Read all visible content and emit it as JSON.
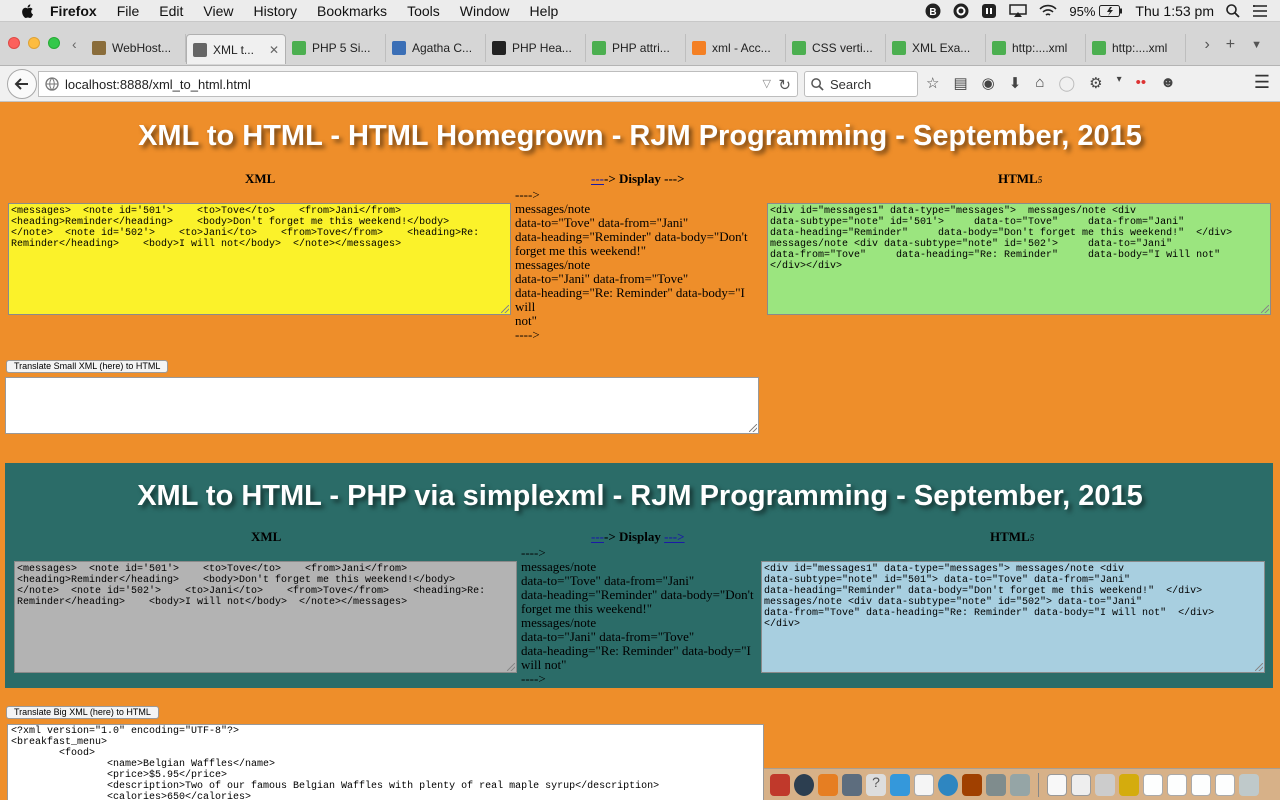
{
  "menubar": {
    "app_name": "Firefox",
    "items": [
      "File",
      "Edit",
      "View",
      "History",
      "Bookmarks",
      "Tools",
      "Window",
      "Help"
    ],
    "battery": "95%",
    "clock": "Thu 1:53 pm"
  },
  "tabs": [
    {
      "label": "WebHost...",
      "icon": "webhost-icon",
      "color": "#8a6d3b",
      "active": false
    },
    {
      "label": "XML t...",
      "icon": "globe-icon",
      "color": "#666666",
      "active": true
    },
    {
      "label": "PHP 5 Si...",
      "icon": "w3schools-icon",
      "color": "#4caf50",
      "active": false
    },
    {
      "label": "Agatha C...",
      "icon": "chrome-style-icon",
      "color": "#3b6fb6",
      "active": false
    },
    {
      "label": "PHP Hea...",
      "icon": "github-icon",
      "color": "#222222",
      "active": false
    },
    {
      "label": "PHP attri...",
      "icon": "w3schools-icon",
      "color": "#4caf50",
      "active": false
    },
    {
      "label": "xml - Acc...",
      "icon": "stackoverflow-icon",
      "color": "#f48024",
      "active": false
    },
    {
      "label": "CSS verti...",
      "icon": "w3schools-icon",
      "color": "#4caf50",
      "active": false
    },
    {
      "label": "XML Exa...",
      "icon": "w3schools-icon",
      "color": "#4caf50",
      "active": false
    },
    {
      "label": "http:....xml",
      "icon": "w3schools-icon",
      "color": "#4caf50",
      "active": false
    },
    {
      "label": "http:....xml",
      "icon": "w3schools-icon",
      "color": "#4caf50",
      "active": false
    }
  ],
  "navbar": {
    "url": "localhost:8888/xml_to_html.html",
    "search_placeholder": "Search"
  },
  "section1": {
    "title": "XML to HTML - HTML Homegrown - RJM Programming - September, 2015",
    "col_xml": "XML",
    "col_display_prefix": "---",
    "col_display": "-> Display --->",
    "col_html": "HTML",
    "col_html_suffix": "5",
    "xml_text": "<messages>  <note id='501'>    <to>Tove</to>    <from>Jani</from>\n<heading>Reminder</heading>    <body>Don't forget me this weekend!</body>\n</note>  <note id='502'>    <to>Jani</to>    <from>Tove</from>    <heading>Re:\nReminder</heading>    <body>I will not</body>  </note></messages>",
    "display_lines": [
      "---->",
      "messages/note",
      "data-to=\"Tove\" data-from=\"Jani\"",
      "data-heading=\"Reminder\" data-body=\"Don't",
      "forget me this weekend!\"",
      "messages/note",
      "data-to=\"Jani\" data-from=\"Tove\"",
      "data-heading=\"Re: Reminder\" data-body=\"I will",
      "not\"",
      "---->"
    ],
    "html_text": "<div id=\"messages1\" data-type=\"messages\">  messages/note <div\ndata-subtype=\"note\" id='501'>     data-to=\"Tove\"     data-from=\"Jani\"\ndata-heading=\"Reminder\"     data-body=\"Don't forget me this weekend!\"  </div>\nmessages/note <div data-subtype=\"note\" id='502'>     data-to=\"Jani\"\ndata-from=\"Tove\"     data-heading=\"Re: Reminder\"     data-body=\"I will not\"\n</div></div>",
    "button_label": "Translate Small XML (here) to HTML"
  },
  "section2": {
    "title": "XML to HTML - PHP via simplexml - RJM Programming - September, 2015",
    "col_xml": "XML",
    "col_display_prefix": "---",
    "col_display": "-> Display ",
    "col_display_suffix": "--->",
    "col_html": "HTML",
    "col_html_suffix": "5",
    "xml_text": "<messages>  <note id='501'>    <to>Tove</to>    <from>Jani</from>\n<heading>Reminder</heading>    <body>Don't forget me this weekend!</body>\n</note>  <note id='502'>    <to>Jani</to>    <from>Tove</from>    <heading>Re:\nReminder</heading>    <body>I will not</body>  </note></messages>",
    "display_lines": [
      "---->",
      "messages/note",
      "data-to=\"Tove\" data-from=\"Jani\"",
      "data-heading=\"Reminder\" data-body=\"Don't",
      "forget me this weekend!\"",
      "messages/note",
      "data-to=\"Jani\" data-from=\"Tove\"",
      "data-heading=\"Re: Reminder\" data-body=\"I",
      "will not\"",
      "---->"
    ],
    "html_text": "<div id=\"messages1\" data-type=\"messages\"> messages/note <div\ndata-subtype=\"note\" id=\"501\"> data-to=\"Tove\" data-from=\"Jani\"\ndata-heading=\"Reminder\" data-body=\"Don't forget me this weekend!\"  </div>\nmessages/note <div data-subtype=\"note\" id=\"502\"> data-to=\"Jani\"\ndata-from=\"Tove\" data-heading=\"Re: Reminder\" data-body=\"I will not\"  </div>\n</div>",
    "button_label": "Translate Big XML (here) to HTML"
  },
  "big_xml_text": "<?xml version=\"1.0\" encoding=\"UTF-8\"?>\n<breakfast_menu>\n        <food>\n                <name>Belgian Waffles</name>\n                <price>$5.95</price>\n                <description>Two of our famous Belgian Waffles with plenty of real maple syrup</description>\n                <calories>650</calories>",
  "colors": {
    "page_bg": "#EE8E2A",
    "panel2_bg": "#2B6C68",
    "xml1_bg": "#FBF22A",
    "html1_bg": "#9BE57F",
    "xml2_bg": "#B3B3B3",
    "html2_bg": "#A8CFE0"
  }
}
